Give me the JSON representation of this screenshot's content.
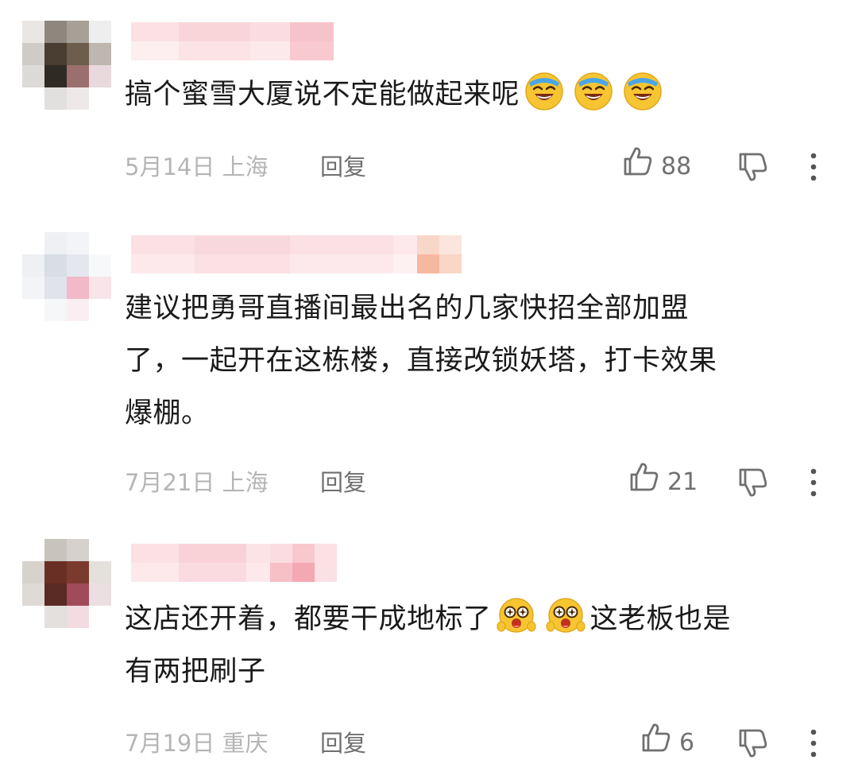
{
  "comments": [
    {
      "text_parts": [
        "搞个蜜雪大厦说不定能做起来呢"
      ],
      "emojis": [
        "laughing-tears-emoji",
        "laughing-tears-emoji",
        "laughing-tears-emoji"
      ],
      "date": "5月14日",
      "location": "上海",
      "reply_label": "回复",
      "likes": "88"
    },
    {
      "text_lines": [
        "建议把勇哥直播间最出名的几家快招全部加盟",
        "了，一起开在这栋楼，直接改锁妖塔，打卡效果",
        "爆棚。"
      ],
      "date": "7月21日",
      "location": "上海",
      "reply_label": "回复",
      "likes": "21"
    },
    {
      "text_line1_a": "这店还开着，都要干成地标了",
      "text_line1_b": "这老板也是",
      "text_line2": "有两把刷子",
      "emojis": [
        "starry-eyed-emoji",
        "starry-eyed-emoji"
      ],
      "date": "7月19日",
      "location": "重庆",
      "reply_label": "回复",
      "likes": "6"
    }
  ],
  "colors": {
    "text": "#1a1a1a",
    "meta": "#b5b5b5",
    "reply": "#6f6f6f",
    "icon": "#707070",
    "emoji_yellow": "#f7c532",
    "username_blur": "#f8d3d8"
  }
}
